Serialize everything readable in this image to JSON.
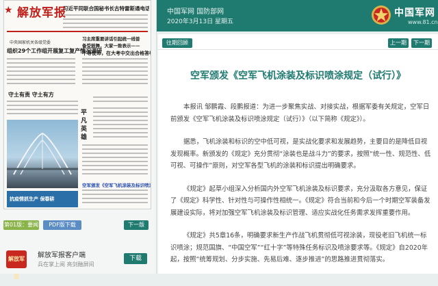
{
  "header": {
    "site_links": "中国军网  国防部网",
    "date": "2020年3月13日  星期五",
    "logo_text": "中国军网",
    "logo_url": "www.81.cn"
  },
  "paper": {
    "masthead": "解放军报",
    "top_headline": "习近平同联合国秘书长古特雷斯通电话",
    "section_label": "中央国家机关各级党委",
    "main_headline": "组织29个工作组开展复工复产情况调研",
    "right_headline1": "习主席重要讲话引起统一线普",
    "right_headline2": "备受鼓舞，大家一致表示——",
    "right_headline3": "不辱使命，在大考中交出合格答卷",
    "mid_headline": "守土有责  守土有方",
    "vertical_text": "平凡英雄",
    "blue_caption": "空军颁发《空军飞机涂装及标识喷涂规定(试行)》",
    "ad_text": "抗疫情抓生产 保春耕"
  },
  "left_buttons": {
    "edition": "第01版：要闻",
    "pdf": "PDF版下载",
    "download": "下一版"
  },
  "app": {
    "icon_text": "解放军报",
    "title": "解放军报客户端",
    "subtitle": "兵在掌上阅 亮剑融屏间",
    "download": "下载"
  },
  "nav": {
    "past": "往期回顾",
    "prev": "上一期",
    "next": "下一期"
  },
  "article": {
    "title": "空军颁发《空军飞机涂装及标识喷涂规定（试行）》",
    "p1": "本报讯 邹鹏霞、段鹏报道：为进一步聚焦实战、对接实战，根据军委有关规定，空军日前颁发《空军飞机涂装及标识喷涂规定（试行）》（以下简称《规定》）。",
    "p2": "据悉，飞机涂装和标识的空中低可视，是实战化要求和发展趋势，主要目的是降低目视发现概率。新颁发的《规定》充分贯彻“涂装也是战斗力”的要求，按照“统一性、规范性、低可视、可操作”原则，对空军各型飞机的涂装和标识提出明确要求。",
    "p3": "《规定》起草小组深入分析国内外空军飞机涂装及标识要求，充分汲取各方意见，保证了《规定》科学性、针对性与可操作性相统一。《规定》符合当前和今后一个时期空军装备发展建设实际，将对加强空军飞机涂装及标识管理、适应实战化任务需求发挥重要作用。",
    "p4": "《规定》共5章16条，明确要求新生产作战飞机贯彻低可视涂装，现役老旧飞机统一标识喷涂；规范国旗、“中国空军”“红十字”等特殊任务标识及喷涂要求等。《规定》自2020年起，按照“统筹规划、分步实施、先易后难、逐步推进”的思路推进贯彻落实。"
  },
  "colors": {
    "accent": "#1f7a70",
    "mast_red": "#c0201b",
    "edition_btn": "#8ab34a",
    "pdf_btn": "#5b8dc4"
  }
}
